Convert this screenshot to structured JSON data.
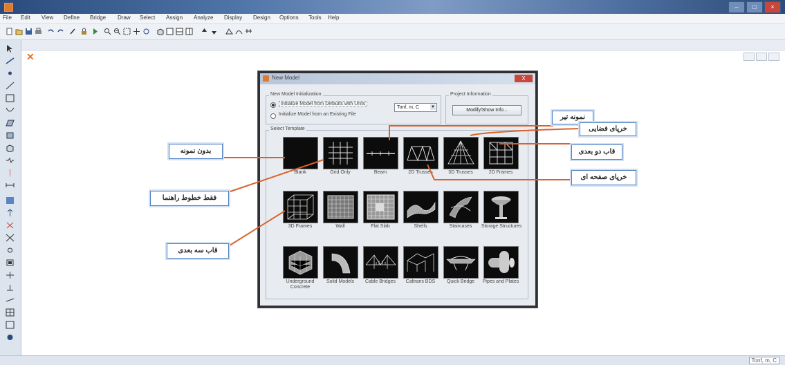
{
  "menubar": {
    "items": [
      {
        "label": "File"
      },
      {
        "label": "Edit"
      },
      {
        "label": "View"
      },
      {
        "label": "Define"
      },
      {
        "label": "Bridge"
      },
      {
        "label": "Draw"
      },
      {
        "label": "Select"
      },
      {
        "label": "Assign"
      },
      {
        "label": "Analyze"
      },
      {
        "label": "Display"
      },
      {
        "label": "Design"
      },
      {
        "label": "Options"
      },
      {
        "label": "Tools"
      },
      {
        "label": "Help"
      }
    ]
  },
  "dialog": {
    "title": "New Model",
    "close_label": "X",
    "init_legend": "New Model Initialization",
    "option_defaults": "Initialize Model from Defaults with Units",
    "option_file": "Initialize Model from an Existing File",
    "units_value": "Tonf, m, C",
    "project_legend": "Project Information",
    "modify_button": "Modify/Show Info...",
    "template_legend": "Select Template",
    "templates": [
      {
        "label": "Blank"
      },
      {
        "label": "Grid Only"
      },
      {
        "label": "Beam"
      },
      {
        "label": "2D Trusses"
      },
      {
        "label": "3D Trusses"
      },
      {
        "label": "2D Frames"
      },
      {
        "label": "3D Frames"
      },
      {
        "label": "Wall"
      },
      {
        "label": "Flat Slab"
      },
      {
        "label": "Shells"
      },
      {
        "label": "Staircases"
      },
      {
        "label": "Storage Structures"
      },
      {
        "label": "Underground Concrete"
      },
      {
        "label": "Solid Models"
      },
      {
        "label": "Cable Bridges"
      },
      {
        "label": "Caltrans BDS"
      },
      {
        "label": "Quick Bridge"
      },
      {
        "label": "Pipes and Plates"
      }
    ]
  },
  "callouts": {
    "no_model": "بدون نمونه",
    "grid_only": "فقط خطوط راهنما",
    "frame_3d": "قاب سه بعدی",
    "beam_model": "نمونه تیر",
    "truss_3d": "خرپای فضایی",
    "frame_2d": "قاب دو بعدی",
    "truss_2d": "خرپای صفحه ای"
  },
  "colors": {
    "accent": "#e07a2e",
    "leader": "#d9622b",
    "callout_border": "#4d7fbf",
    "dialog_bg": "#e8ecf1"
  }
}
